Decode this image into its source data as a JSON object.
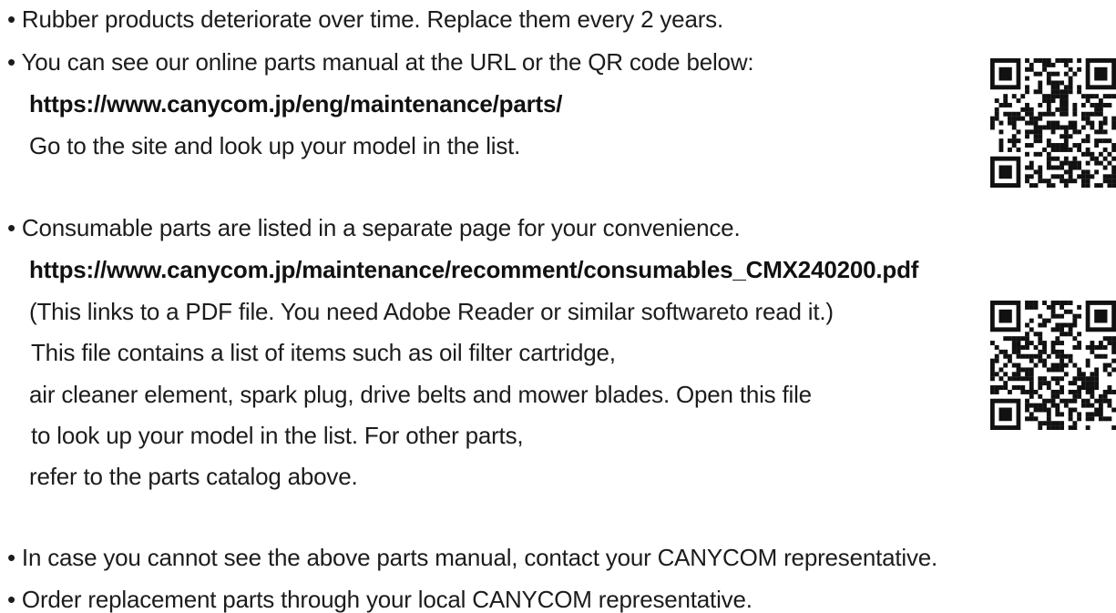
{
  "section1": {
    "bullet1": "• Rubber products deteriorate over time. Replace them every 2 years.",
    "bullet2": "• You can see our online parts manual at the URL or the QR code below:",
    "url": "https://www.canycom.jp/eng/maintenance/parts/",
    "instruction": "Go to the site and look up your model in the list."
  },
  "section2": {
    "bullet": "• Consumable parts are listed in a separate page for your convenience.",
    "url": "https://www.canycom.jp/maintenance/recomment/consumables_CMX240200.pdf",
    "note": "(This links to a PDF file. You need Adobe Reader or similar softwareto read it.)",
    "lines": [
      "This file contains a list of items such as oil filter cartridge,",
      "air cleaner element, spark plug, drive belts and mower blades. Open this file",
      "to look up your model in the list. For other parts,",
      "refer to the parts catalog above."
    ]
  },
  "section3": {
    "bullet1": "• In case you cannot see the above parts manual, contact your CANYCOM representative.",
    "bullet2": "• Order replacement parts through your local CANYCOM representative."
  },
  "icons": {
    "qr_parts": "qr-code-icon",
    "qr_consumables": "qr-code-icon"
  }
}
